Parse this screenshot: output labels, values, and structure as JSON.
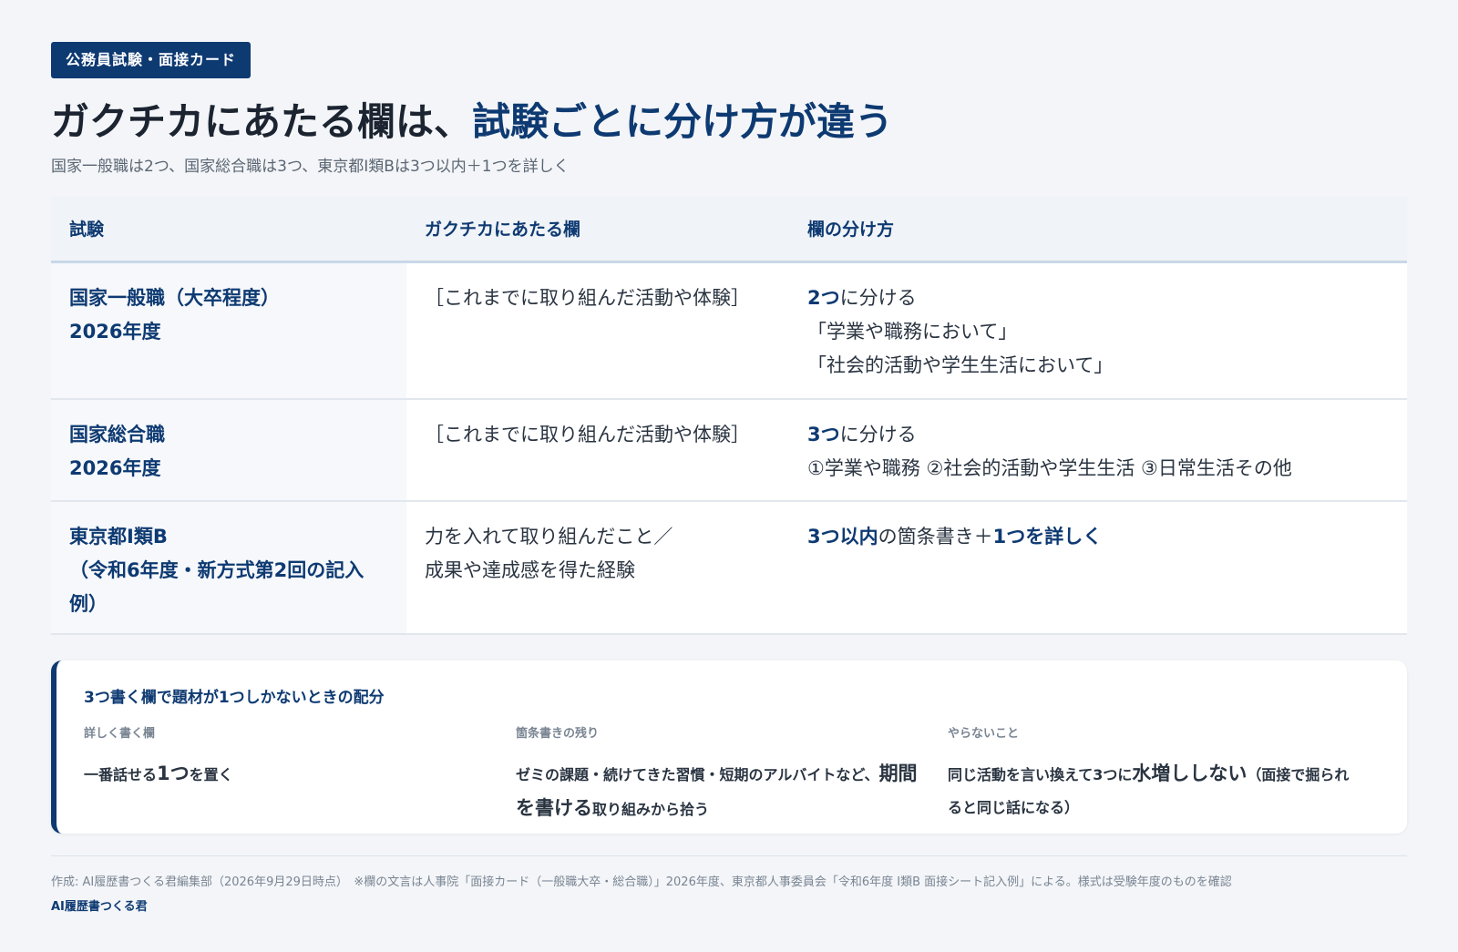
{
  "tag": "公務員試験・面接カード",
  "title": {
    "part1": "ガクチカにあたる欄は、",
    "part2": "試験ごとに分け方が違う"
  },
  "subtitle": "国家一般職は2つ、国家総合職は3つ、東京都Ⅰ類Bは3つ以内＋1つを詳しく",
  "table": {
    "headers": [
      "試験",
      "ガクチカにあたる欄",
      "欄の分け方"
    ],
    "rows": [
      {
        "exam_line1": "国家一般職（大卒程度）",
        "exam_line2": "2026年度",
        "field": "［これまでに取り組んだ活動や体験］",
        "split_strong": "2つ",
        "split_rest": "に分ける",
        "split_line2": "「学業や職務において」",
        "split_line3": "「社会的活動や学生生活において」"
      },
      {
        "exam_line1": "国家総合職",
        "exam_line2": "2026年度",
        "field": "［これまでに取り組んだ活動や体験］",
        "split_strong": "3つ",
        "split_rest": "に分ける",
        "split_line2": "①学業や職務 ②社会的活動や学生生活 ③日常生活その他"
      },
      {
        "exam_line1": "東京都Ⅰ類B",
        "exam_line2": "（令和6年度・新方式第2回の記入例）",
        "field_line1": "力を入れて取り組んだこと／",
        "field_line2": "成果や達成感を得た経験",
        "split_strong1": "3つ以内",
        "split_mid": "の箇条書き＋",
        "split_strong2": "1つを詳しく"
      }
    ]
  },
  "note": {
    "title": "3つ書く欄で題材が1つしかないときの配分",
    "cols": [
      {
        "label": "詳しく書く欄",
        "pre": "一番話せる",
        "big": "1つ",
        "post": "を置く"
      },
      {
        "label": "箇条書きの残り",
        "pre": "ゼミの課題・続けてきた習慣・短期のアルバイトなど、",
        "big": "期間を書ける",
        "post": "取り組みから拾う"
      },
      {
        "label": "やらないこと",
        "pre": "同じ活動を言い換えて3つに",
        "big": "水増ししない",
        "post": "（面接で掘られると同じ話になる）"
      }
    ]
  },
  "footer": "作成: AI履歴書つくる君編集部（2026年9月29日時点）　※欄の文言は人事院「面接カード（一般職大卒・総合職）」2026年度、東京都人事委員会「令和6年度 Ⅰ類B 面接シート記入例」による。様式は受験年度のものを確認",
  "brand": "AI履歴書つくる君",
  "colors": {
    "accent": "#0e3a72",
    "background": "#f3f5f8"
  }
}
